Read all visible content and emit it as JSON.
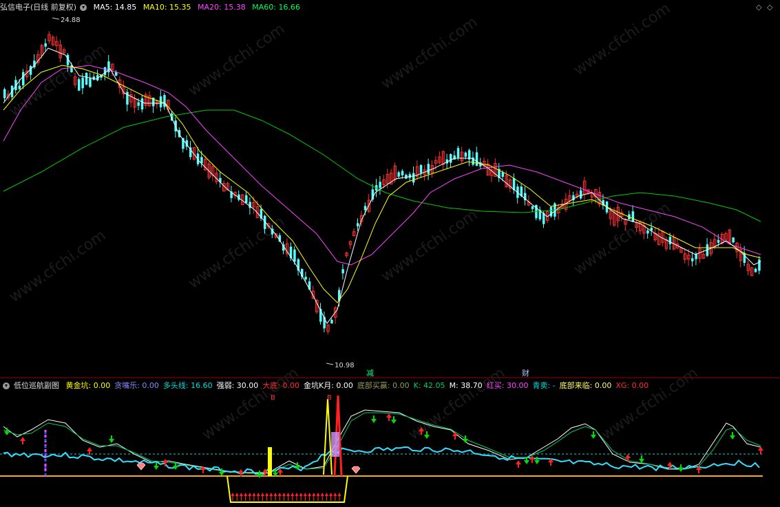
{
  "main": {
    "title": "弘信电子(日线 前复权)",
    "ma5": "MA5: 14.85",
    "ma10": "MA10: 15.35",
    "ma20": "MA20: 15.38",
    "ma60": "MA60: 16.66",
    "high_label": "24.88",
    "low_label": "10.98",
    "bottom_mark_1": "减",
    "bottom_mark_2": "财",
    "watermark": "www.cfchi.com"
  },
  "sub": {
    "title": "低位巡航副图",
    "items": [
      {
        "text": "黄金坑: 0.00",
        "color": "#ffff00"
      },
      {
        "text": "贪嘴乐: 0.00",
        "color": "#8888ff"
      },
      {
        "text": "多头线: 16.60",
        "color": "#00dddd"
      },
      {
        "text": "强弱: 30.00",
        "color": "#ffffff"
      },
      {
        "text": "大底: 0.00",
        "color": "#ff3030"
      },
      {
        "text": "金坑K月: 0.00",
        "color": "#ffffff"
      },
      {
        "text": "底部买赢: 0.00",
        "color": "#999955"
      },
      {
        "text": "K: 42.05",
        "color": "#00cc66"
      },
      {
        "text": "M: 38.70",
        "color": "#ffffff"
      },
      {
        "text": "红买: 30.00",
        "color": "#ff44ff"
      },
      {
        "text": "青卖: -",
        "color": "#00dddd"
      },
      {
        "text": "底部来临: 0.00",
        "color": "#ffff66"
      },
      {
        "text": "XG: 0.00",
        "color": "#ff3030"
      }
    ],
    "b_label": "B"
  },
  "colors": {
    "up": "#ff3030",
    "down": "#54ffff",
    "ma5": "#ffffff",
    "ma10": "#ffff00",
    "ma20": "#ff44ff",
    "ma60": "#00cc00"
  }
}
